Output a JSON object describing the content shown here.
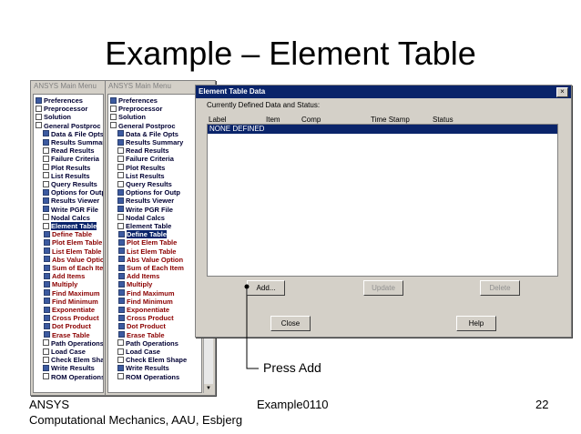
{
  "slide": {
    "title": "Example – Element Table",
    "callout": "Press Add",
    "footer_left_1": "ANSYS",
    "footer_left_2": "Computational Mechanics, AAU, Esbjerg",
    "footer_center": "Example0110",
    "page_number": "22"
  },
  "menu_left": {
    "title": "ANSYS Main Menu",
    "items": [
      {
        "label": "Preferences",
        "kind": "doc",
        "color": "dark"
      },
      {
        "label": "Preprocessor",
        "kind": "exp",
        "color": "dark"
      },
      {
        "label": "Solution",
        "kind": "exp",
        "color": "dark"
      },
      {
        "label": "General Postproc",
        "kind": "exp",
        "color": "dark"
      },
      {
        "label": "Data & File Opts",
        "kind": "doc",
        "color": "dark"
      },
      {
        "label": "Results Summary",
        "kind": "doc",
        "color": "dark"
      },
      {
        "label": "Read Results",
        "kind": "exp",
        "color": "dark"
      },
      {
        "label": "Failure Criteria",
        "kind": "exp",
        "color": "dark"
      },
      {
        "label": "Plot Results",
        "kind": "exp",
        "color": "dark"
      },
      {
        "label": "List Results",
        "kind": "exp",
        "color": "dark"
      },
      {
        "label": "Query Results",
        "kind": "exp",
        "color": "dark"
      },
      {
        "label": "Options for Outp",
        "kind": "doc",
        "color": "dark"
      },
      {
        "label": "Results Viewer",
        "kind": "doc",
        "color": "dark"
      },
      {
        "label": "Write PGR File",
        "kind": "doc",
        "color": "dark"
      },
      {
        "label": "Nodal Calcs",
        "kind": "exp",
        "color": "dark"
      },
      {
        "label": "Element Table",
        "kind": "exp",
        "color": "dark",
        "selected": true
      },
      {
        "label": "Define Table",
        "kind": "doc",
        "color": "red",
        "indent": 1
      },
      {
        "label": "Plot Elem Table",
        "kind": "doc",
        "color": "red",
        "indent": 1
      },
      {
        "label": "List Elem Table",
        "kind": "doc",
        "color": "red",
        "indent": 1
      },
      {
        "label": "Abs Value Option",
        "kind": "doc",
        "color": "red",
        "indent": 1
      },
      {
        "label": "Sum of Each Item",
        "kind": "doc",
        "color": "red",
        "indent": 1
      },
      {
        "label": "Add Items",
        "kind": "doc",
        "color": "red",
        "indent": 1
      },
      {
        "label": "Multiply",
        "kind": "doc",
        "color": "red",
        "indent": 1
      },
      {
        "label": "Find Maximum",
        "kind": "doc",
        "color": "red",
        "indent": 1
      },
      {
        "label": "Find Minimum",
        "kind": "doc",
        "color": "red",
        "indent": 1
      },
      {
        "label": "Exponentiate",
        "kind": "doc",
        "color": "red",
        "indent": 1
      },
      {
        "label": "Cross Product",
        "kind": "doc",
        "color": "red",
        "indent": 1
      },
      {
        "label": "Dot Product",
        "kind": "doc",
        "color": "red",
        "indent": 1
      },
      {
        "label": "Erase Table",
        "kind": "doc",
        "color": "red",
        "indent": 1
      },
      {
        "label": "Path Operations",
        "kind": "exp",
        "color": "dark"
      },
      {
        "label": "Load Case",
        "kind": "exp",
        "color": "dark"
      },
      {
        "label": "Check Elem Shape",
        "kind": "exp",
        "color": "dark"
      },
      {
        "label": "Write Results",
        "kind": "doc",
        "color": "dark"
      },
      {
        "label": "ROM Operations",
        "kind": "exp",
        "color": "dark"
      }
    ]
  },
  "menu_right": {
    "title": "ANSYS Main Menu",
    "items": [
      {
        "label": "Preferences",
        "kind": "doc",
        "color": "dark"
      },
      {
        "label": "Preprocessor",
        "kind": "exp",
        "color": "dark"
      },
      {
        "label": "Solution",
        "kind": "exp",
        "color": "dark"
      },
      {
        "label": "General Postproc",
        "kind": "exp",
        "color": "dark"
      },
      {
        "label": "Data & File Opts",
        "kind": "doc",
        "color": "dark"
      },
      {
        "label": "Results Summary",
        "kind": "doc",
        "color": "dark"
      },
      {
        "label": "Read Results",
        "kind": "exp",
        "color": "dark"
      },
      {
        "label": "Failure Criteria",
        "kind": "exp",
        "color": "dark"
      },
      {
        "label": "Plot Results",
        "kind": "exp",
        "color": "dark"
      },
      {
        "label": "List Results",
        "kind": "exp",
        "color": "dark"
      },
      {
        "label": "Query Results",
        "kind": "exp",
        "color": "dark"
      },
      {
        "label": "Options for Outp",
        "kind": "doc",
        "color": "dark"
      },
      {
        "label": "Results Viewer",
        "kind": "doc",
        "color": "dark"
      },
      {
        "label": "Write PGR File",
        "kind": "doc",
        "color": "dark"
      },
      {
        "label": "Nodal Calcs",
        "kind": "exp",
        "color": "dark"
      },
      {
        "label": "Element Table",
        "kind": "exp",
        "color": "dark"
      },
      {
        "label": "Define Table",
        "kind": "doc",
        "color": "red",
        "indent": 1,
        "selected": true
      },
      {
        "label": "Plot Elem Table",
        "kind": "doc",
        "color": "red",
        "indent": 1
      },
      {
        "label": "List Elem Table",
        "kind": "doc",
        "color": "red",
        "indent": 1
      },
      {
        "label": "Abs Value Option",
        "kind": "doc",
        "color": "red",
        "indent": 1
      },
      {
        "label": "Sum of Each Item",
        "kind": "doc",
        "color": "red",
        "indent": 1
      },
      {
        "label": "Add Items",
        "kind": "doc",
        "color": "red",
        "indent": 1
      },
      {
        "label": "Multiply",
        "kind": "doc",
        "color": "red",
        "indent": 1
      },
      {
        "label": "Find Maximum",
        "kind": "doc",
        "color": "red",
        "indent": 1
      },
      {
        "label": "Find Minimum",
        "kind": "doc",
        "color": "red",
        "indent": 1
      },
      {
        "label": "Exponentiate",
        "kind": "doc",
        "color": "red",
        "indent": 1
      },
      {
        "label": "Cross Product",
        "kind": "doc",
        "color": "red",
        "indent": 1
      },
      {
        "label": "Dot Product",
        "kind": "doc",
        "color": "red",
        "indent": 1
      },
      {
        "label": "Erase Table",
        "kind": "doc",
        "color": "red",
        "indent": 1
      },
      {
        "label": "Path Operations",
        "kind": "exp",
        "color": "dark"
      },
      {
        "label": "Load Case",
        "kind": "exp",
        "color": "dark"
      },
      {
        "label": "Check Elem Shape",
        "kind": "exp",
        "color": "dark"
      },
      {
        "label": "Write Results",
        "kind": "doc",
        "color": "dark"
      },
      {
        "label": "ROM Operations",
        "kind": "exp",
        "color": "dark"
      }
    ]
  },
  "dialog": {
    "title": "Element Table Data",
    "close_glyph": "×",
    "status_label": "Currently Defined Data and Status:",
    "columns": [
      "Label",
      "Item",
      "Comp",
      "Time Stamp",
      "Status"
    ],
    "selected_row": "NONE DEFINED",
    "buttons": {
      "add": "Add...",
      "update": "Update",
      "delete": "Delete",
      "close": "Close",
      "help": "Help"
    }
  },
  "colors": {
    "selection": "#0a246a",
    "window_face": "#d4d0c8",
    "menu_text_dark": "#000033",
    "menu_text_red": "#8b0000"
  }
}
